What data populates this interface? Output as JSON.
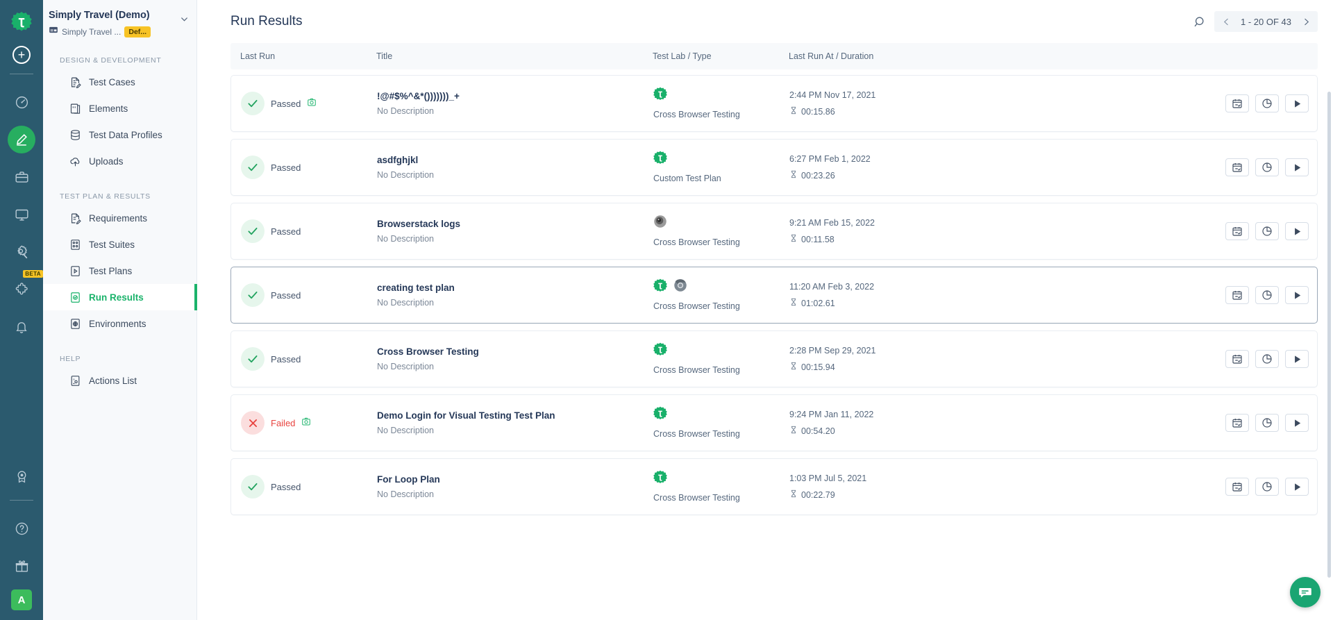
{
  "rail": {
    "logo_icon": "testsigma-logo-icon",
    "add_label": "+",
    "items": [
      {
        "name": "dashboard-icon",
        "label": "Dashboard",
        "badge": ""
      },
      {
        "name": "design-edit-icon",
        "label": "Design & Development",
        "badge": ""
      },
      {
        "name": "briefcase-icon",
        "label": "Projects",
        "badge": ""
      },
      {
        "name": "monitor-icon",
        "label": "Test Lab",
        "badge": ""
      },
      {
        "name": "settings-search-icon",
        "label": "Settings",
        "badge": ""
      },
      {
        "name": "puzzle-plugin-icon",
        "label": "Add-ons",
        "badge": "BETA"
      },
      {
        "name": "bell-icon",
        "label": "Notifications",
        "badge": ""
      },
      {
        "name": "award-badge-icon",
        "label": "Licence",
        "badge": ""
      }
    ],
    "bottom_items": [
      {
        "name": "help-circle-icon",
        "label": "Help"
      },
      {
        "name": "gift-icon",
        "label": "What's New"
      }
    ],
    "avatar_initial": "A"
  },
  "sidebar": {
    "project_name": "Simply Travel (Demo)",
    "project_sub": "Simply Travel ...",
    "project_tag": "Def...",
    "caret_icon": "chevron-down-icon",
    "groups": [
      {
        "label": "DESIGN & DEVELOPMENT",
        "items": [
          {
            "label": "Test Cases",
            "icon": "test-cases-icon",
            "active": false
          },
          {
            "label": "Elements",
            "icon": "elements-icon",
            "active": false
          },
          {
            "label": "Test Data Profiles",
            "icon": "database-icon",
            "active": false
          },
          {
            "label": "Uploads",
            "icon": "cloud-upload-icon",
            "active": false
          }
        ]
      },
      {
        "label": "TEST PLAN & RESULTS",
        "items": [
          {
            "label": "Requirements",
            "icon": "requirements-icon",
            "active": false
          },
          {
            "label": "Test Suites",
            "icon": "test-suites-icon",
            "active": false
          },
          {
            "label": "Test Plans",
            "icon": "test-plans-icon",
            "active": false
          },
          {
            "label": "Run Results",
            "icon": "run-results-icon",
            "active": true
          },
          {
            "label": "Environments",
            "icon": "environments-globe-icon",
            "active": false
          }
        ]
      },
      {
        "label": "HELP",
        "items": [
          {
            "label": "Actions List",
            "icon": "actions-list-icon",
            "active": false
          }
        ]
      }
    ]
  },
  "header": {
    "title": "Run Results",
    "search_icon": "search-icon",
    "prev_icon": "chevron-left-icon",
    "next_icon": "chevron-right-icon",
    "pagination_label": "1 - 20  OF  43"
  },
  "table": {
    "columns": [
      "Last Run",
      "Title",
      "Test Lab / Type",
      "Last Run At / Duration"
    ],
    "action_icons": [
      "schedule-calendar-icon",
      "report-piechart-icon",
      "run-play-icon"
    ],
    "rows": [
      {
        "status": "Passed",
        "status_kind": "pass",
        "has_camera": true,
        "title": "!@#$%^&*()))))))_+",
        "description": "No Description",
        "lab_icons": [
          "testsigma-lab-icon"
        ],
        "lab_type": "Cross Browser Testing",
        "last_run_at": "2:44 PM Nov 17, 2021",
        "duration": "00:15.86",
        "selected": false
      },
      {
        "status": "Passed",
        "status_kind": "pass",
        "has_camera": false,
        "title": "asdfghjkl",
        "description": "No Description",
        "lab_icons": [
          "testsigma-lab-icon"
        ],
        "lab_type": "Custom Test Plan",
        "last_run_at": "6:27 PM Feb 1, 2022",
        "duration": "00:23.26",
        "selected": false
      },
      {
        "status": "Passed",
        "status_kind": "pass",
        "has_camera": false,
        "title": "Browserstack logs",
        "description": "No Description",
        "lab_icons": [
          "browserstack-lab-icon"
        ],
        "lab_type": "Cross Browser Testing",
        "last_run_at": "9:21 AM Feb 15, 2022",
        "duration": "00:11.58",
        "selected": false
      },
      {
        "status": "Passed",
        "status_kind": "pass",
        "has_camera": false,
        "title": "creating test plan",
        "description": "No Description",
        "lab_icons": [
          "testsigma-lab-icon",
          "chrome-browser-icon"
        ],
        "lab_type": "Cross Browser Testing",
        "last_run_at": "11:20 AM Feb 3, 2022",
        "duration": "01:02.61",
        "selected": true
      },
      {
        "status": "Passed",
        "status_kind": "pass",
        "has_camera": false,
        "title": "Cross Browser Testing",
        "description": "No Description",
        "lab_icons": [
          "testsigma-lab-icon"
        ],
        "lab_type": "Cross Browser Testing",
        "last_run_at": "2:28 PM Sep 29, 2021",
        "duration": "00:15.94",
        "selected": false
      },
      {
        "status": "Failed",
        "status_kind": "fail",
        "has_camera": true,
        "title": "Demo Login for Visual Testing Test Plan",
        "description": "No Description",
        "lab_icons": [
          "testsigma-lab-icon"
        ],
        "lab_type": "Cross Browser Testing",
        "last_run_at": "9:24 PM Jan 11, 2022",
        "duration": "00:54.20",
        "selected": false
      },
      {
        "status": "Passed",
        "status_kind": "pass",
        "has_camera": false,
        "title": "For Loop Plan",
        "description": "No Description",
        "lab_icons": [
          "testsigma-lab-icon"
        ],
        "lab_type": "Cross Browser Testing",
        "last_run_at": "1:03 PM Jul 5, 2021",
        "duration": "00:22.79",
        "selected": false
      }
    ]
  },
  "chat": {
    "icon": "chat-bubble-icon"
  },
  "colors": {
    "rail_bg": "#2b5a6e",
    "accent_green": "#1bb36b",
    "fail_red": "#e8433f",
    "badge_yellow": "#f7c325"
  }
}
